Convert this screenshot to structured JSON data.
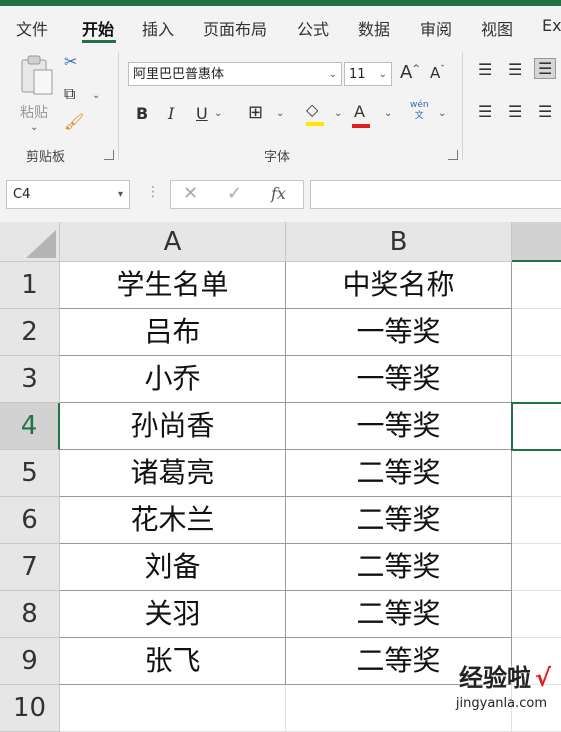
{
  "ribbon_tabs": [
    "文件",
    "开始",
    "插入",
    "页面布局",
    "公式",
    "数据",
    "审阅",
    "视图",
    "Ex"
  ],
  "active_tab": "开始",
  "clipboard": {
    "paste_label": "粘贴",
    "group_label": "剪贴板"
  },
  "font": {
    "family": "阿里巴巴普惠体",
    "size": "11",
    "group_label": "字体",
    "bold": "B",
    "italic": "I",
    "underline": "U",
    "grow": "A",
    "shrink": "A",
    "font_color": "A",
    "phonetic": "wén",
    "phonetic_sub": "文"
  },
  "formula_bar": {
    "name_box": "C4",
    "fx": "fx",
    "formula": ""
  },
  "sheet": {
    "columns": [
      "A",
      "B"
    ],
    "rows": [
      {
        "n": "1",
        "a": "学生名单",
        "b": "中奖名称"
      },
      {
        "n": "2",
        "a": "吕布",
        "b": "一等奖"
      },
      {
        "n": "3",
        "a": "小乔",
        "b": "一等奖"
      },
      {
        "n": "4",
        "a": "孙尚香",
        "b": "一等奖"
      },
      {
        "n": "5",
        "a": "诸葛亮",
        "b": "二等奖"
      },
      {
        "n": "6",
        "a": "花木兰",
        "b": "二等奖"
      },
      {
        "n": "7",
        "a": "刘备",
        "b": "二等奖"
      },
      {
        "n": "8",
        "a": "关羽",
        "b": "二等奖"
      },
      {
        "n": "9",
        "a": "张飞",
        "b": "二等奖"
      },
      {
        "n": "10",
        "a": "",
        "b": ""
      }
    ],
    "selected_row": "4"
  },
  "watermark": {
    "text": "经验啦",
    "check": "√",
    "url": "jingyanla.com"
  },
  "colors": {
    "accent": "#217346",
    "red": "#e02020",
    "yellow": "#ffe600"
  }
}
